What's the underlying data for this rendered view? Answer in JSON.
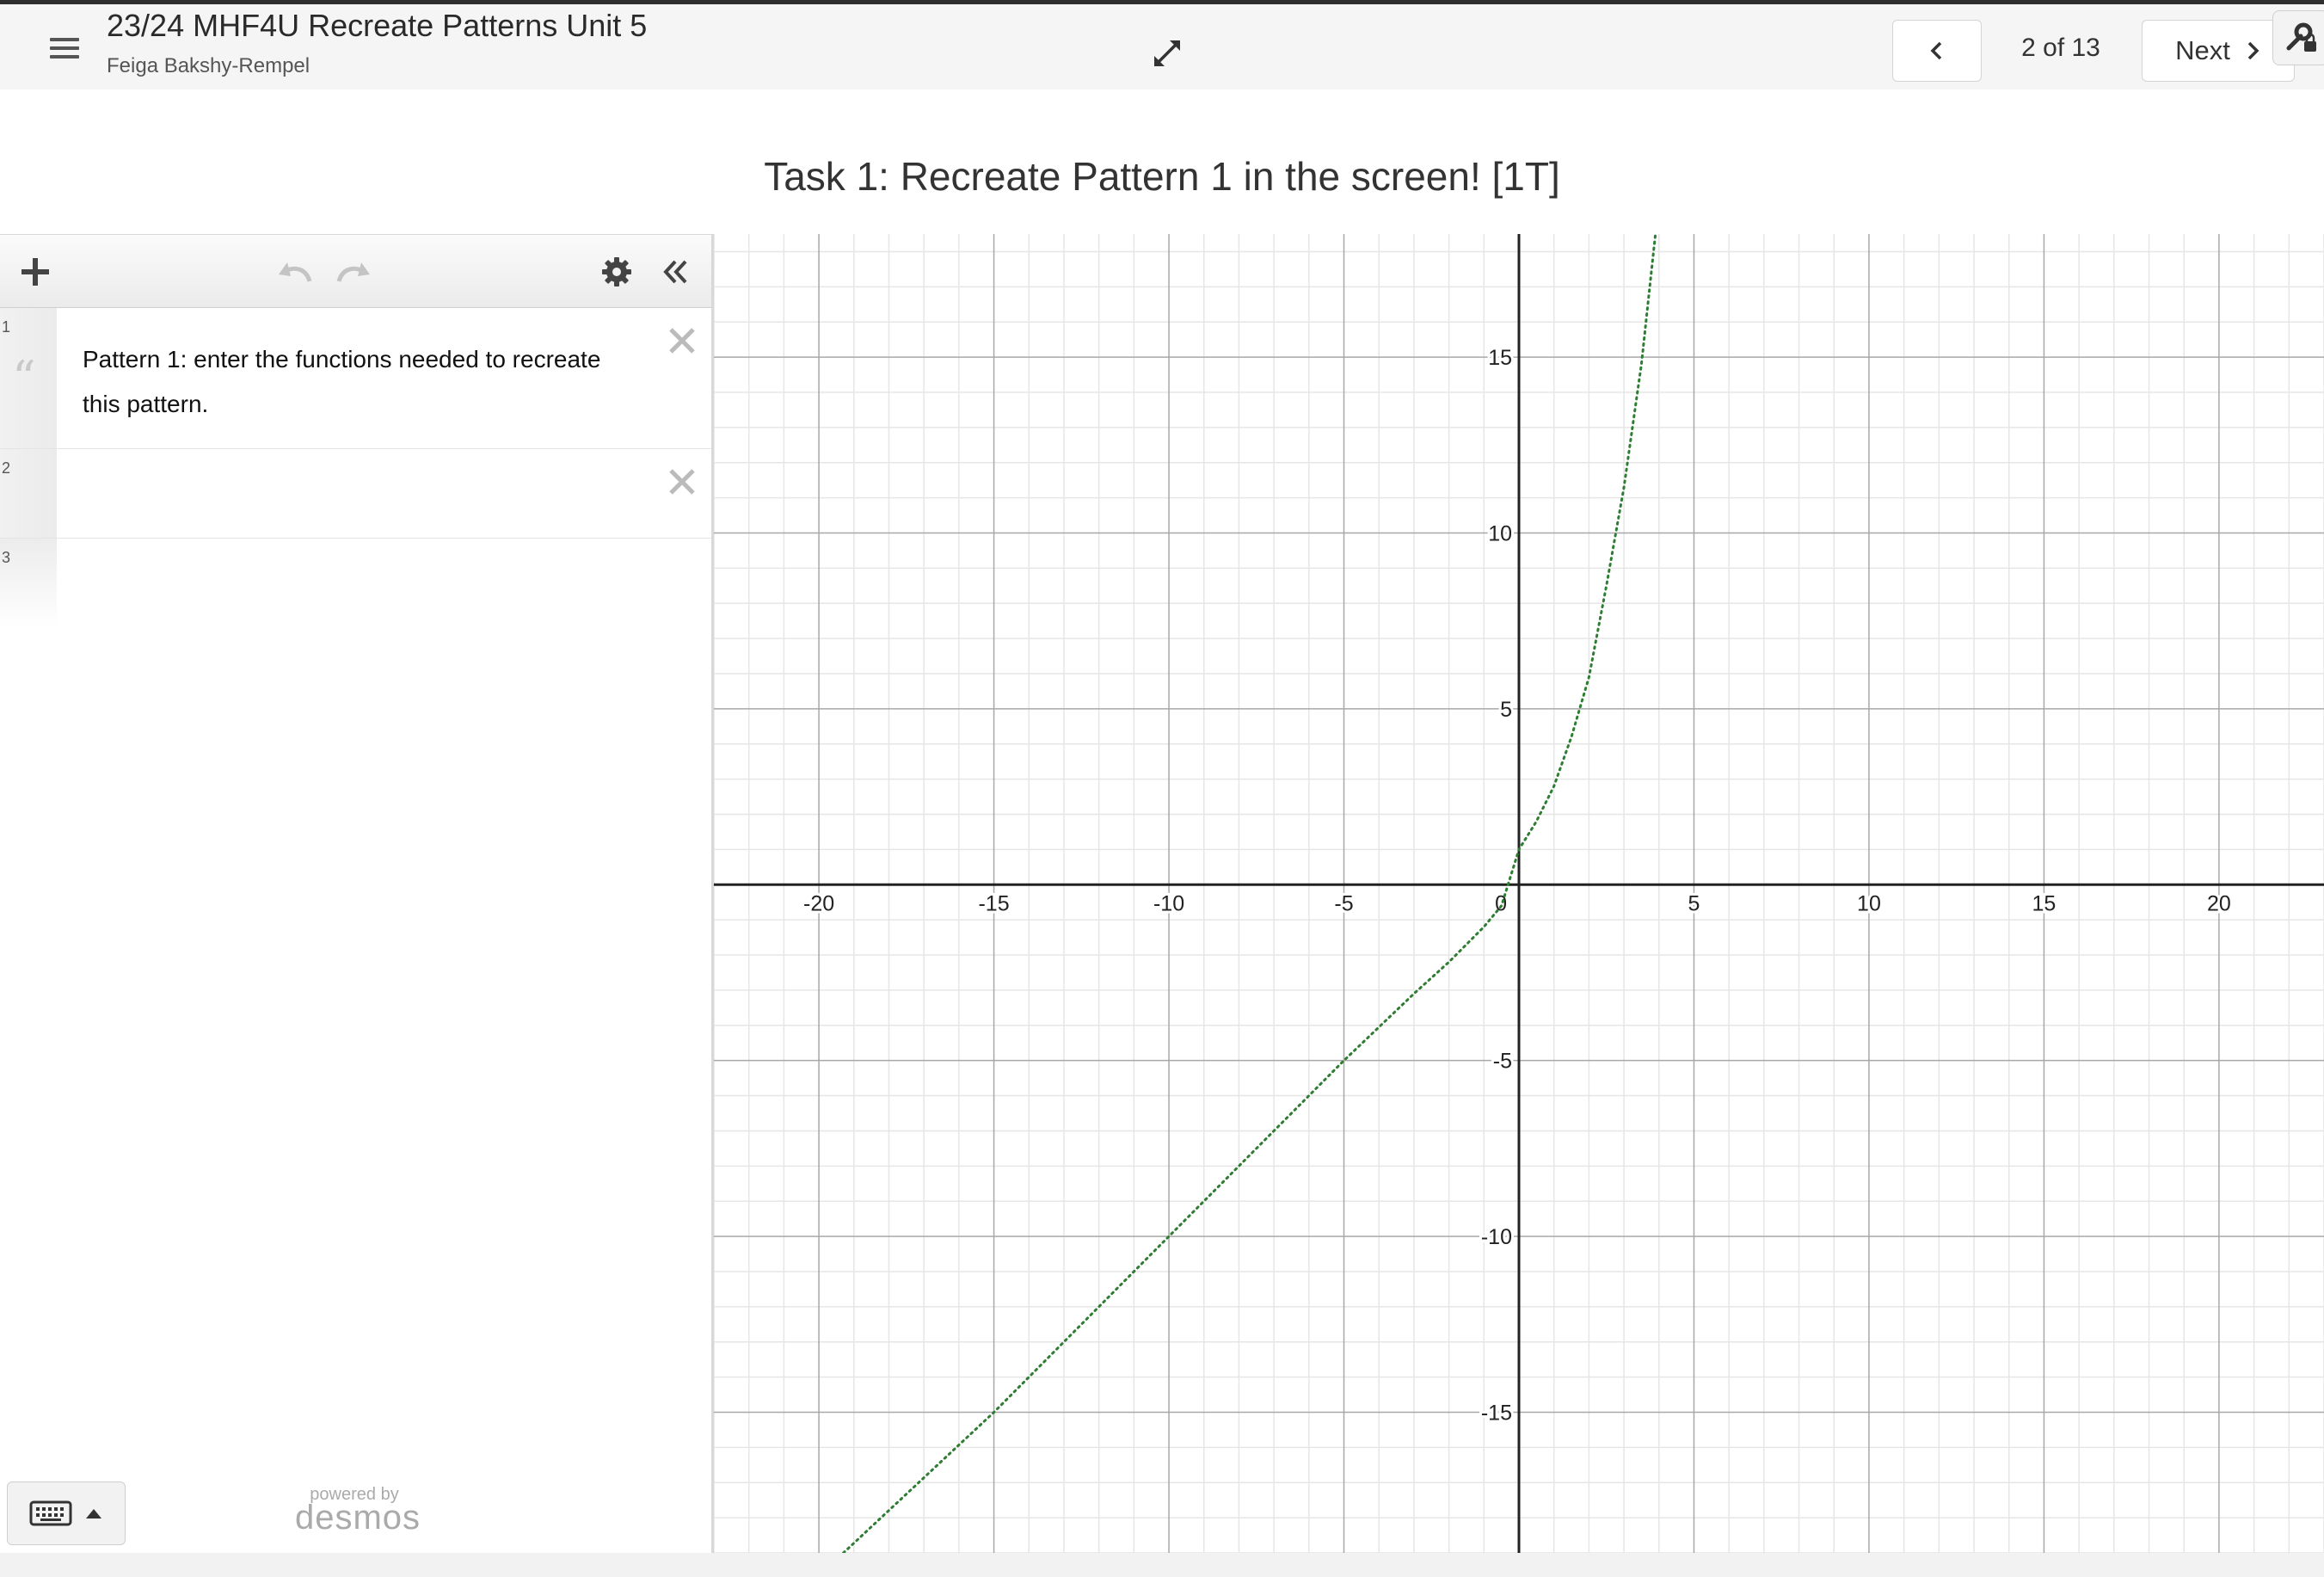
{
  "header": {
    "title": "23/24 MHF4U Recreate Patterns Unit 5",
    "author": "Feiga Bakshy-Rempel",
    "page_indicator": "2 of 13",
    "next_label": "Next"
  },
  "screen": {
    "title": "Task 1: Recreate Pattern 1 in the screen! [1T]"
  },
  "expressions": [
    {
      "number": "1",
      "text": "Pattern 1: enter the functions needed to recreate this pattern."
    },
    {
      "number": "2",
      "text": ""
    },
    {
      "number": "3",
      "text": ""
    }
  ],
  "branding": {
    "powered_by": "powered by",
    "logo": "desmos"
  },
  "icons": {
    "menu": "hamburger-menu-icon",
    "expand": "expand-arrows-icon",
    "prev": "chevron-left-icon",
    "next": "chevron-right-icon",
    "add": "plus-icon",
    "undo": "undo-icon",
    "redo": "redo-icon",
    "settings": "gear-icon",
    "collapse": "double-chevron-left-icon",
    "delete": "close-icon",
    "keypad": "keyboard-icon",
    "graph_settings": "wrench-lock-icon"
  },
  "chart_data": {
    "type": "line",
    "xlim": [
      -23,
      23
    ],
    "ylim": [
      -19,
      18.5
    ],
    "x_ticks": [
      -20,
      -15,
      -10,
      -5,
      0,
      5,
      10,
      15,
      20
    ],
    "y_ticks": [
      -15,
      -10,
      -5,
      5,
      10,
      15
    ],
    "grid": true,
    "series": [
      {
        "style": "dotted",
        "color": "#2e7d32",
        "x": [
          -19.3,
          -15,
          -10,
          -5,
          -3,
          -2,
          -1,
          -0.5,
          0,
          0.5,
          1,
          1.5,
          2,
          2.5,
          3,
          3.5,
          3.9
        ],
        "y": [
          -19,
          -15,
          -10,
          -5,
          -3.1,
          -2.2,
          -1.2,
          -0.6,
          1,
          1.8,
          2.8,
          4.2,
          5.9,
          8.5,
          11.3,
          14.8,
          18.5
        ]
      }
    ]
  }
}
